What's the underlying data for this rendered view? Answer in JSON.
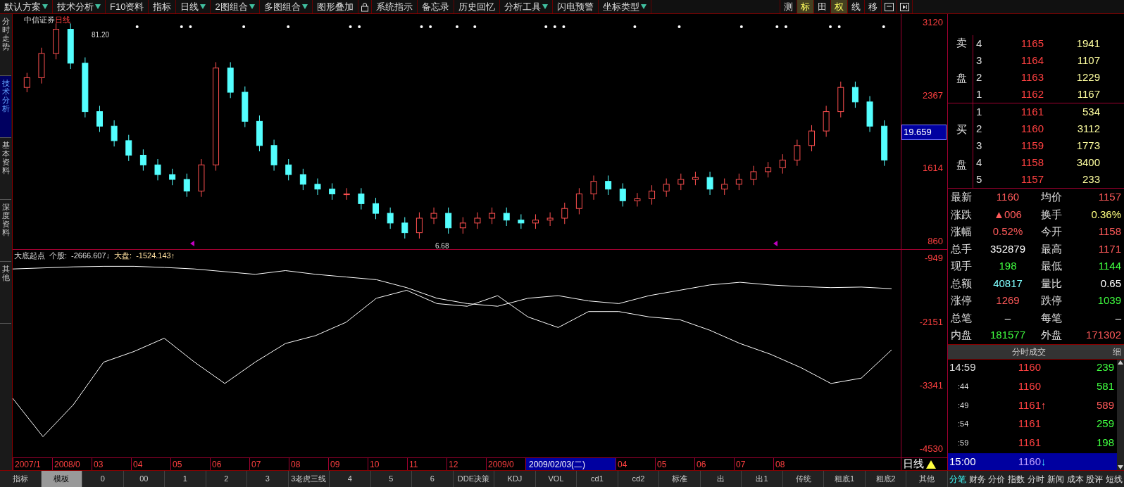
{
  "toolbar": {
    "items": [
      {
        "kind": "button",
        "label": "默认方案",
        "dropdown": true
      },
      {
        "kind": "button",
        "label": "技术分析",
        "dropdown": true
      },
      {
        "kind": "button",
        "label": "F10资料",
        "dropdown": false
      },
      {
        "kind": "button",
        "label": "指标",
        "dropdown": false
      },
      {
        "kind": "button",
        "label": "日线",
        "dropdown": true
      },
      {
        "kind": "button",
        "label": "2图组合",
        "dropdown": true
      },
      {
        "kind": "button",
        "label": "多图组合",
        "dropdown": true
      },
      {
        "kind": "button",
        "label": "图形叠加",
        "dropdown": false
      },
      {
        "kind": "lock"
      },
      {
        "kind": "button",
        "label": "系统指示",
        "dropdown": false
      },
      {
        "kind": "button",
        "label": "备忘录",
        "dropdown": false
      },
      {
        "kind": "button",
        "label": "历史回忆",
        "dropdown": false
      },
      {
        "kind": "button",
        "label": "分析工具",
        "dropdown": true
      },
      {
        "kind": "button",
        "label": "闪电预警",
        "dropdown": false
      },
      {
        "kind": "button",
        "label": "坐标类型",
        "dropdown": true
      }
    ],
    "view_buttons": [
      {
        "label": "测",
        "selected": false
      },
      {
        "label": "标",
        "selected": true
      },
      {
        "label": "田",
        "selected": false
      },
      {
        "label": "权",
        "selected": true
      },
      {
        "label": "线",
        "selected": false
      },
      {
        "label": "移",
        "selected": false
      }
    ]
  },
  "sidebar": {
    "tabs": [
      {
        "label": "分时走势",
        "selected": false
      },
      {
        "label": "技术分析",
        "selected": true
      },
      {
        "label": "基本资料",
        "selected": false
      },
      {
        "label": "深度资料",
        "selected": false
      },
      {
        "label": "其他",
        "selected": false
      }
    ]
  },
  "chart": {
    "stock": "中信证券",
    "period": "日线",
    "high_label": "81.20",
    "low_label": "6.68",
    "current_value": "19.659",
    "chart_data": {
      "type": "candlestick",
      "ylim": [
        773,
        3207
      ],
      "yticks": [
        3120,
        2367,
        1614,
        860
      ],
      "ohlc": [
        [
          2450,
          2600,
          2400,
          2550
        ],
        [
          2550,
          2860,
          2490,
          2800
        ],
        [
          2800,
          3110,
          2740,
          3050
        ],
        [
          3050,
          3110,
          2640,
          2700
        ],
        [
          2700,
          2760,
          2140,
          2200
        ],
        [
          2200,
          2260,
          1990,
          2050
        ],
        [
          2050,
          2110,
          1840,
          1900
        ],
        [
          1900,
          1960,
          1690,
          1750
        ],
        [
          1750,
          1810,
          1590,
          1650
        ],
        [
          1650,
          1710,
          1490,
          1550
        ],
        [
          1550,
          1610,
          1440,
          1500
        ],
        [
          1500,
          1560,
          1320,
          1380
        ],
        [
          1380,
          1710,
          1320,
          1650
        ],
        [
          1650,
          2710,
          1590,
          2650
        ],
        [
          2650,
          2710,
          2340,
          2400
        ],
        [
          2400,
          2460,
          2040,
          2100
        ],
        [
          2100,
          2160,
          1790,
          1850
        ],
        [
          1850,
          1910,
          1590,
          1650
        ],
        [
          1650,
          1710,
          1490,
          1550
        ],
        [
          1550,
          1610,
          1390,
          1450
        ],
        [
          1450,
          1510,
          1340,
          1400
        ],
        [
          1400,
          1460,
          1290,
          1350
        ],
        [
          1350,
          1410,
          1290,
          1350
        ],
        [
          1350,
          1410,
          1190,
          1250
        ],
        [
          1250,
          1310,
          1090,
          1150
        ],
        [
          1150,
          1210,
          990,
          1050
        ],
        [
          1050,
          1110,
          890,
          950
        ],
        [
          950,
          1160,
          890,
          1100
        ],
        [
          1100,
          1210,
          1040,
          1150
        ],
        [
          1150,
          1210,
          940,
          1000
        ],
        [
          1000,
          1110,
          940,
          1050
        ],
        [
          1050,
          1160,
          990,
          1100
        ],
        [
          1100,
          1210,
          1040,
          1150
        ],
        [
          1150,
          1210,
          1020,
          1080
        ],
        [
          1080,
          1140,
          990,
          1050
        ],
        [
          1050,
          1140,
          990,
          1080
        ],
        [
          1080,
          1160,
          1020,
          1100
        ],
        [
          1100,
          1260,
          1040,
          1200
        ],
        [
          1200,
          1410,
          1140,
          1350
        ],
        [
          1350,
          1540,
          1290,
          1480
        ],
        [
          1480,
          1540,
          1340,
          1400
        ],
        [
          1400,
          1460,
          1220,
          1280
        ],
        [
          1280,
          1360,
          1220,
          1300
        ],
        [
          1300,
          1440,
          1240,
          1380
        ],
        [
          1380,
          1510,
          1320,
          1450
        ],
        [
          1450,
          1560,
          1390,
          1500
        ],
        [
          1500,
          1580,
          1440,
          1520
        ],
        [
          1520,
          1580,
          1340,
          1400
        ],
        [
          1400,
          1510,
          1340,
          1450
        ],
        [
          1450,
          1560,
          1390,
          1500
        ],
        [
          1500,
          1640,
          1440,
          1580
        ],
        [
          1580,
          1680,
          1520,
          1620
        ],
        [
          1620,
          1760,
          1560,
          1700
        ],
        [
          1700,
          1910,
          1640,
          1850
        ],
        [
          1850,
          2060,
          1790,
          2000
        ],
        [
          2000,
          2260,
          1940,
          2200
        ],
        [
          2200,
          2510,
          2140,
          2450
        ],
        [
          2450,
          2510,
          2240,
          2300
        ],
        [
          2300,
          2360,
          1990,
          2050
        ],
        [
          2050,
          2110,
          1640,
          1700
        ]
      ]
    }
  },
  "indicator": {
    "name": "大底起点",
    "stock_label": "个股:",
    "stock_value": "-2666.607↓",
    "market_label": "大盘:",
    "market_value": "-1524.143↑",
    "chart_data": {
      "type": "line",
      "ylim": [
        -4690,
        -790
      ],
      "yticks": [
        -949,
        -2151,
        -3341,
        -4530
      ],
      "series": [
        {
          "color": "#ffffff",
          "values": [
            -1150,
            -1130,
            -1110,
            -1100,
            -1100,
            -1120,
            -1150,
            -1200,
            -1250,
            -1180,
            -1250,
            -1300,
            -1350,
            -1500,
            -1700,
            -1800,
            -1850,
            -1700,
            -1650,
            -1750,
            -1800,
            -1650,
            -1550,
            -1450,
            -1400,
            -1450,
            -1480,
            -1500,
            -1490,
            -1520
          ]
        },
        {
          "color": "#ffffff",
          "values": [
            -3580,
            -4300,
            -3700,
            -2900,
            -2700,
            -2450,
            -2900,
            -3300,
            -2900,
            -2550,
            -2400,
            -2150,
            -1700,
            -1550,
            -1800,
            -1850,
            -1650,
            -2050,
            -2250,
            -1950,
            -1950,
            -2050,
            -2100,
            -2300,
            -2550,
            -2750,
            -3000,
            -3300,
            -3200,
            -2670
          ]
        }
      ]
    }
  },
  "date_axis": {
    "labels": [
      {
        "label": "2007/1",
        "selected": false
      },
      {
        "label": "2008/0",
        "selected": false
      },
      {
        "label": "03",
        "selected": false
      },
      {
        "label": "04",
        "selected": false
      },
      {
        "label": "05",
        "selected": false
      },
      {
        "label": "06",
        "selected": false
      },
      {
        "label": "07",
        "selected": false
      },
      {
        "label": "08",
        "selected": false
      },
      {
        "label": "09",
        "selected": false
      },
      {
        "label": "10",
        "selected": false
      },
      {
        "label": "11",
        "selected": false
      },
      {
        "label": "12",
        "selected": false
      },
      {
        "label": "2009/0",
        "selected": false
      },
      {
        "label": "2009/02/03(二)",
        "selected": true
      },
      {
        "label": "04",
        "selected": false
      },
      {
        "label": "05",
        "selected": false
      },
      {
        "label": "06",
        "selected": false
      },
      {
        "label": "07",
        "selected": false
      },
      {
        "label": "08",
        "selected": false
      }
    ],
    "period": "日线"
  },
  "order_book": {
    "sell_label": "卖盘",
    "buy_label": "买盘",
    "sell": [
      {
        "rank": "4",
        "price": "1165",
        "volume": "1941"
      },
      {
        "rank": "3",
        "price": "1164",
        "volume": "1107"
      },
      {
        "rank": "2",
        "price": "1163",
        "volume": "1229"
      },
      {
        "rank": "1",
        "price": "1162",
        "volume": "1167"
      }
    ],
    "buy": [
      {
        "rank": "1",
        "price": "1161",
        "volume": "534"
      },
      {
        "rank": "2",
        "price": "1160",
        "volume": "3112"
      },
      {
        "rank": "3",
        "price": "1159",
        "volume": "1773"
      },
      {
        "rank": "4",
        "price": "1158",
        "volume": "3400"
      },
      {
        "rank": "5",
        "price": "1157",
        "volume": "233"
      }
    ]
  },
  "stats": [
    {
      "label": "最新",
      "value": "1160",
      "color": "#ff5a5a"
    },
    {
      "label": "均价",
      "value": "1157",
      "color": "#ff5a5a"
    },
    {
      "label": "涨跌",
      "value": "▲006",
      "color": "#ff5a5a"
    },
    {
      "label": "换手",
      "value": "0.36%",
      "color": "#ffff80"
    },
    {
      "label": "涨幅",
      "value": "0.52%",
      "color": "#ff5a5a"
    },
    {
      "label": "今开",
      "value": "1158",
      "color": "#ff5a5a"
    },
    {
      "label": "总手",
      "value": "352879",
      "color": "#ffffff"
    },
    {
      "label": "最高",
      "value": "1171",
      "color": "#ff5a5a"
    },
    {
      "label": "现手",
      "value": "198",
      "color": "#40ff40"
    },
    {
      "label": "最低",
      "value": "1144",
      "color": "#40ff40"
    },
    {
      "label": "总额",
      "value": "40817",
      "color": "#80ffff"
    },
    {
      "label": "量比",
      "value": "0.65",
      "color": "#ffffff"
    },
    {
      "label": "涨停",
      "value": "1269",
      "color": "#ff5a5a"
    },
    {
      "label": "跌停",
      "value": "1039",
      "color": "#40ff40"
    },
    {
      "label": "总笔",
      "value": "–",
      "color": "#ffffff"
    },
    {
      "label": "每笔",
      "value": "–",
      "color": "#ffffff"
    },
    {
      "label": "内盘",
      "value": "181577",
      "color": "#40ff40"
    },
    {
      "label": "外盘",
      "value": "171302",
      "color": "#ff5a5a"
    }
  ],
  "ticks": {
    "title": "分时成交",
    "detail": "细",
    "rows": [
      {
        "time": "14:59",
        "price": "1160",
        "volume": "239",
        "color": "#40ff40",
        "selected": false
      },
      {
        "time": ":44",
        "price": "1160",
        "volume": "581",
        "color": "#40ff40",
        "selected": false
      },
      {
        "time": ":49",
        "price": "1161",
        "arrow": "↑",
        "volume": "589",
        "color": "#ff5a5a",
        "selected": false
      },
      {
        "time": ":54",
        "price": "1161",
        "volume": "259",
        "color": "#40ff40",
        "selected": false
      },
      {
        "time": ":59",
        "price": "1161",
        "volume": "198",
        "color": "#40ff40",
        "selected": false
      },
      {
        "time": "15:00",
        "price": "1160",
        "arrow": "↓",
        "selected": true
      }
    ]
  },
  "bottom_tabs": [
    {
      "label": "指标",
      "selected": false
    },
    {
      "label": "模板",
      "selected": true
    },
    {
      "label": "0",
      "selected": false
    },
    {
      "label": "00",
      "selected": false
    },
    {
      "label": "1",
      "selected": false
    },
    {
      "label": "2",
      "selected": false
    },
    {
      "label": "3",
      "selected": false
    },
    {
      "label": "3老虎三线",
      "selected": false
    },
    {
      "label": "4",
      "selected": false
    },
    {
      "label": "5",
      "selected": false
    },
    {
      "label": "6",
      "selected": false
    },
    {
      "label": "DDE决策",
      "selected": false
    },
    {
      "label": "KDJ",
      "selected": false
    },
    {
      "label": "VOL",
      "selected": false
    },
    {
      "label": "cd1",
      "selected": false
    },
    {
      "label": "cd2",
      "selected": false
    },
    {
      "label": "标准",
      "selected": false
    },
    {
      "label": "出",
      "selected": false
    },
    {
      "label": "出1",
      "selected": false
    },
    {
      "label": "传统",
      "selected": false
    },
    {
      "label": "粗底1",
      "selected": false
    },
    {
      "label": "粗底2",
      "selected": false
    },
    {
      "label": "其他",
      "selected": false
    }
  ],
  "panel_tabs": [
    {
      "label": "分笔",
      "selected": true
    },
    {
      "label": "财务",
      "selected": false
    },
    {
      "label": "分价",
      "selected": false
    },
    {
      "label": "指数",
      "selected": false
    },
    {
      "label": "分时",
      "selected": false
    },
    {
      "label": "新闻",
      "selected": false
    },
    {
      "label": "成本",
      "selected": false
    },
    {
      "label": "股评",
      "selected": false
    },
    {
      "label": "短线",
      "selected": false
    }
  ]
}
